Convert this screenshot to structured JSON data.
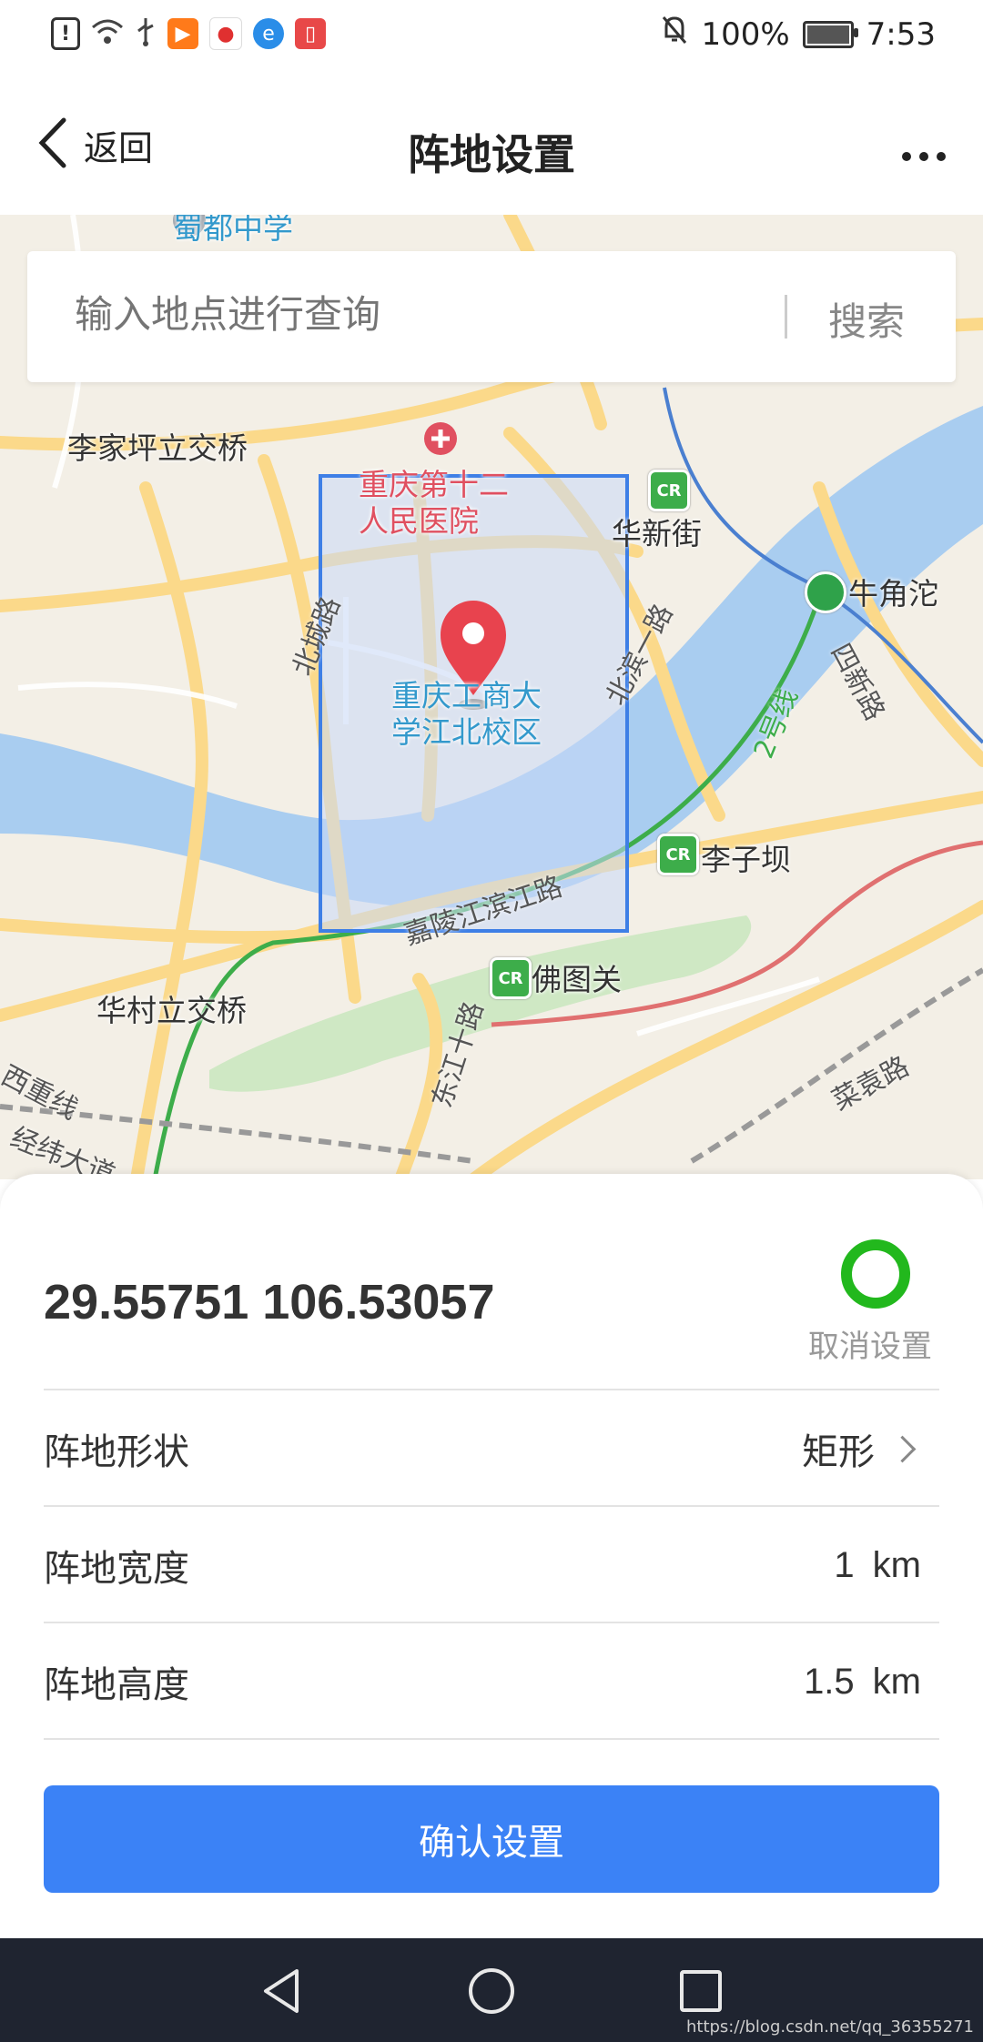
{
  "status_bar": {
    "battery": "100%",
    "time": "7:53",
    "battery_level": 1.0,
    "icons": [
      "alert-icon",
      "wifi-icon",
      "usb-icon",
      "play-app-icon",
      "map-app-icon",
      "browser-app-icon",
      "reader-app-icon"
    ],
    "right_icons": [
      "mute-bell-icon",
      "battery-icon"
    ]
  },
  "nav": {
    "back_label": "返回",
    "title": "阵地设置",
    "more_label": "···"
  },
  "search": {
    "placeholder": "输入地点进行查询",
    "button_label": "搜索"
  },
  "map": {
    "labels": {
      "lijiaping": "李家坪立交桥",
      "hospital_line1": "重庆第十二",
      "hospital_line2": "人民医院",
      "huaxinjie": "华新街",
      "niujiaotuo": "牛角沱",
      "school_line1": "重庆工商大",
      "school_line2": "学江北校区",
      "liziba": "李子坝",
      "futuguan": "佛图关",
      "huacun": "华村立交桥",
      "top_partial": "蜀都中学"
    },
    "road_labels": {
      "beicheng": "北城路",
      "beibin": "北滨一路",
      "sifang": "四新路",
      "line2": "2号线",
      "jialing": "嘉陵江滨江路",
      "dongjiang": "东江十路",
      "xizhong": "西重线",
      "jingwei": "经纬大道",
      "caiyuan": "菜袁路"
    },
    "colors": {
      "land": "#f3efe6",
      "road": "#fbd98a",
      "river": "#a9cdf0",
      "rect_border": "#3e7fe6",
      "metro_green": "#2fa24a",
      "rail_red": "#e07070"
    }
  },
  "panel": {
    "coordinates": "29.55751 106.53057",
    "cancel_label": "取消设置",
    "rows": [
      {
        "label": "阵地形状",
        "value": "矩形",
        "unit": ""
      },
      {
        "label": "阵地宽度",
        "value": "1",
        "unit": "km"
      },
      {
        "label": "阵地高度",
        "value": "1.5",
        "unit": "km"
      }
    ],
    "confirm_label": "确认设置"
  },
  "watermark": "https://blog.csdn.net/qq_36355271"
}
